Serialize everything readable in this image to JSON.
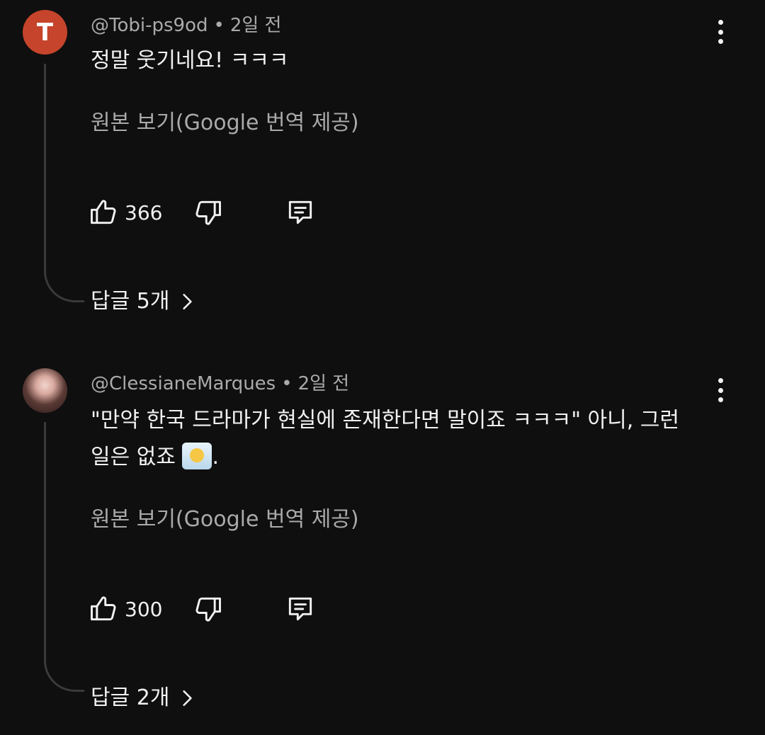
{
  "comments": [
    {
      "avatar_letter": "T",
      "author": "@Tobi-ps9od",
      "separator": "•",
      "time": "2일 전",
      "text": "정말 웃기네요! ㅋㅋㅋ",
      "translate_label": "원본 보기(Google 번역 제공)",
      "likes": "366",
      "replies_label": "답글 5개"
    },
    {
      "author": "@ClessianeMarques",
      "separator": "•",
      "time": "2일 전",
      "text_line1": "\"만약 한국 드라마가 현실에 존재한다면 말이죠 ㅋㅋㅋ\" 아니, 그런",
      "text_line2": "일은 없죠",
      "text_end": ".",
      "emoji_name": "face-in-clouds-emoji",
      "translate_label": "원본 보기(Google 번역 제공)",
      "likes": "300",
      "replies_label": "답글 2개"
    }
  ],
  "colors": {
    "background": "#0f0f0f",
    "primary_text": "#f1f1f1",
    "secondary_text": "#aaaaaa",
    "avatar_t": "#c5442b",
    "thread_line": "#3a3a3a"
  },
  "icons": [
    "like-icon",
    "dislike-icon",
    "reply-icon",
    "chevron-right-icon",
    "more-vert-icon"
  ]
}
